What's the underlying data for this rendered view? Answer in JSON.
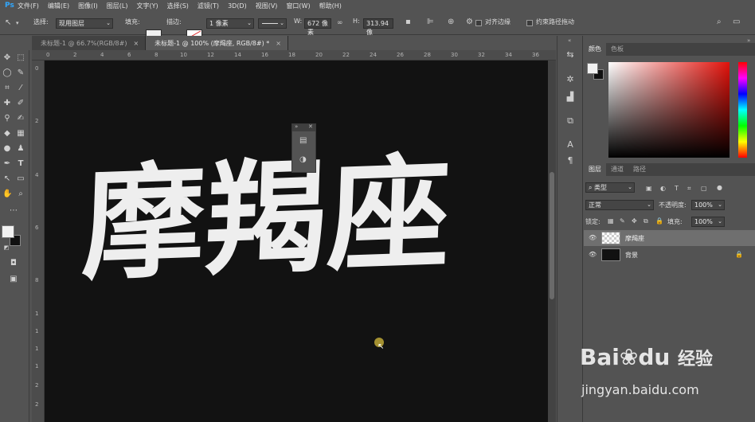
{
  "menubar": {
    "logo": "Ps",
    "items": [
      "文件(F)",
      "编辑(E)",
      "图像(I)",
      "图层(L)",
      "文字(Y)",
      "选择(S)",
      "滤镜(T)",
      "3D(D)",
      "视图(V)",
      "窗口(W)",
      "帮助(H)"
    ]
  },
  "options": {
    "select_label": "选择:",
    "select_value": "现用图层",
    "fill_label": "填充:",
    "stroke_label": "描边:",
    "stroke_width": "1 像素",
    "w_label": "W:",
    "w_value": "672 像素",
    "h_label": "H:",
    "h_value": "313.94 像",
    "align_edges": "对齐边缘",
    "constrain_path": "约束路径拖动"
  },
  "tabs": [
    {
      "label": "未标题-1 @ 66.7%(RGB/8#)",
      "close": "×"
    },
    {
      "label": "未标题-1 @ 100% (摩羯座, RGB/8#) *",
      "close": "×"
    }
  ],
  "ruler": {
    "h_ticks": [
      "0",
      "2",
      "4",
      "6",
      "8",
      "10",
      "12",
      "14",
      "16",
      "18",
      "20",
      "22",
      "24",
      "26",
      "28",
      "30",
      "32",
      "34",
      "36"
    ],
    "v_ticks": [
      "0",
      "2",
      "4",
      "6",
      "8",
      "1",
      "1",
      "1",
      "1",
      "2",
      "2"
    ]
  },
  "canvas": {
    "headline": "摩羯座",
    "background": "#121212",
    "text_color": "#eeeeee"
  },
  "color_panel": {
    "tabs": [
      "颜色",
      "色板"
    ]
  },
  "layers_panel": {
    "tabs": [
      "图层",
      "通道",
      "路径"
    ],
    "filter_kind": "类型",
    "blend_mode": "正常",
    "opacity_label": "不透明度:",
    "opacity_value": "100%",
    "lock_label": "锁定:",
    "fill_label": "填充:",
    "fill_value": "100%",
    "layers": [
      {
        "name": "摩羯座",
        "selected": true
      },
      {
        "name": "背景",
        "selected": false,
        "locked": true
      }
    ]
  },
  "watermark": {
    "brand": "Bai",
    "brand_paw": "du",
    "brand_cn": "经验",
    "url": "jingyan.baidu.com"
  }
}
